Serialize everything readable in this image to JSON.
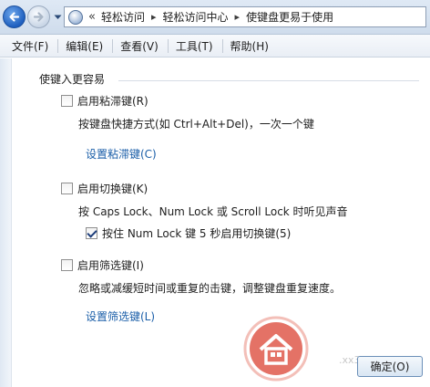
{
  "breadcrumb": {
    "overflow": "«",
    "items": [
      "轻松访问",
      "轻松访问中心",
      "使键盘更易于使用"
    ],
    "separator": "▸"
  },
  "menu": [
    "文件(F)",
    "编辑(E)",
    "查看(V)",
    "工具(T)",
    "帮助(H)"
  ],
  "section_title": "使键入更容易",
  "sticky_keys": {
    "label": "启用粘滞键(R)",
    "checked": false,
    "description": "按键盘快捷方式(如 Ctrl+Alt+Del)，一次一个键",
    "link": "设置粘滞键(C)"
  },
  "toggle_keys": {
    "label": "启用切换键(K)",
    "checked": false,
    "description": "按 Caps Lock、Num Lock 或 Scroll Lock 时听见声音",
    "sub_option": {
      "label": "按住 Num Lock 键 5 秒启用切换键(5)",
      "checked": true
    }
  },
  "filter_keys": {
    "label": "启用筛选键(I)",
    "checked": false,
    "description": "忽略或减缓短时间或重复的击键，调整键盘重复速度。",
    "link": "设置筛选键(L)"
  },
  "ok_button": "确定(O)",
  "watermark_text": ".xx3...c",
  "colors": {
    "link": "#1a5ea8",
    "watermark": "#e05a4c"
  }
}
